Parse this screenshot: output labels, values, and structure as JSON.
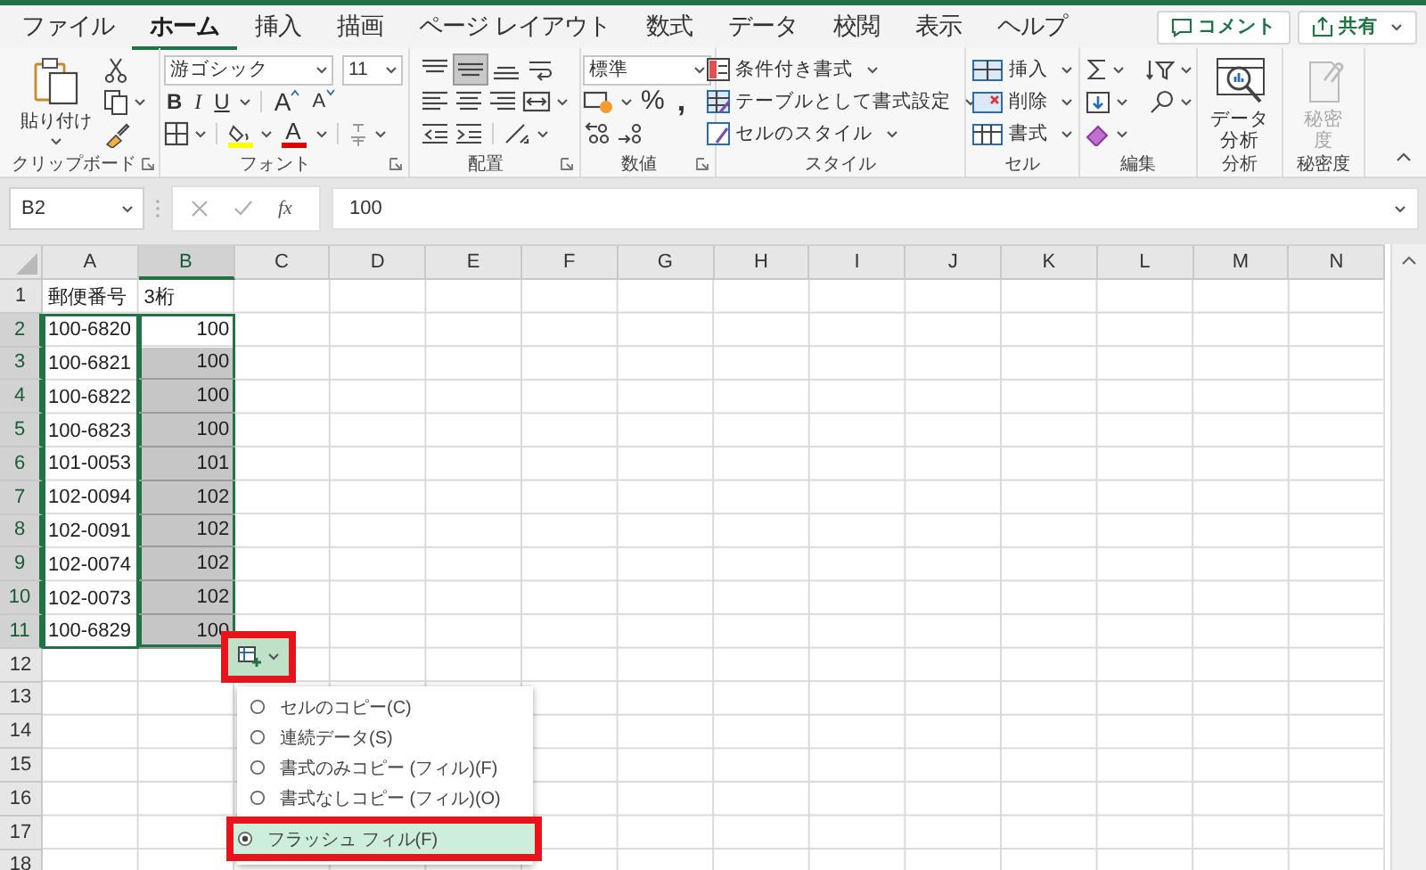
{
  "tabs": [
    {
      "label": "ファイル",
      "selected": false
    },
    {
      "label": "ホーム",
      "selected": true
    },
    {
      "label": "挿入",
      "selected": false
    },
    {
      "label": "描画",
      "selected": false
    },
    {
      "label": "ページ レイアウト",
      "selected": false
    },
    {
      "label": "数式",
      "selected": false
    },
    {
      "label": "データ",
      "selected": false
    },
    {
      "label": "校閲",
      "selected": false
    },
    {
      "label": "表示",
      "selected": false
    },
    {
      "label": "ヘルプ",
      "selected": false
    }
  ],
  "comment_button": {
    "label": "コメント"
  },
  "share_button": {
    "label": "共有"
  },
  "ribbon_groups": [
    {
      "kind": "clipboard",
      "label": "クリップボード",
      "paste_label": "貼り付け"
    },
    {
      "kind": "font",
      "label": "フォント",
      "font_name": "游ゴシック",
      "font_size": "11",
      "bold": "B",
      "italic": "I",
      "underline": "U",
      "grow": "A",
      "shrink": "A",
      "font_color": "A"
    },
    {
      "kind": "alignment",
      "label": "配置",
      "middle_align_pressed": true
    },
    {
      "kind": "number",
      "label": "数値",
      "format": "標準",
      "percent": "%",
      "comma": ","
    },
    {
      "kind": "styles",
      "label": "スタイル",
      "commands": [
        "条件付き書式",
        "テーブルとして書式設定",
        "セルのスタイル"
      ]
    },
    {
      "kind": "cells",
      "label": "セル",
      "commands": [
        "挿入",
        "削除",
        "書式"
      ]
    },
    {
      "kind": "editing",
      "label": "編集"
    },
    {
      "kind": "analysis",
      "label": "分析",
      "button": "データ分析"
    },
    {
      "kind": "sensitivity",
      "label": "秘密度",
      "button": "秘密度",
      "disabled": true
    }
  ],
  "formula_bar": {
    "name_box": "B2",
    "function_button": "fx",
    "value": "100"
  },
  "sheet": {
    "columns": [
      {
        "label": "A",
        "selected": false
      },
      {
        "label": "B",
        "selected": true
      },
      {
        "label": "C",
        "selected": false
      },
      {
        "label": "D",
        "selected": false
      },
      {
        "label": "E",
        "selected": false
      },
      {
        "label": "F",
        "selected": false
      },
      {
        "label": "G",
        "selected": false
      },
      {
        "label": "H",
        "selected": false
      },
      {
        "label": "I",
        "selected": false
      },
      {
        "label": "J",
        "selected": false
      },
      {
        "label": "K",
        "selected": false
      },
      {
        "label": "L",
        "selected": false
      },
      {
        "label": "M",
        "selected": false
      },
      {
        "label": "N",
        "selected": false
      }
    ],
    "rows": [
      {
        "number": "1",
        "selected": false,
        "cells": [
          {
            "text": "郵便番号",
            "kind": "text",
            "shaded": false
          },
          {
            "text": "3桁",
            "kind": "text",
            "shaded": false
          }
        ]
      },
      {
        "number": "2",
        "selected": true,
        "cells": [
          {
            "text": "100-6820",
            "kind": "text",
            "shaded": false
          },
          {
            "text": "100",
            "kind": "number",
            "shaded": false
          }
        ]
      },
      {
        "number": "3",
        "selected": true,
        "cells": [
          {
            "text": "100-6821",
            "kind": "text",
            "shaded": false
          },
          {
            "text": "100",
            "kind": "number",
            "shaded": true
          }
        ]
      },
      {
        "number": "4",
        "selected": true,
        "cells": [
          {
            "text": "100-6822",
            "kind": "text",
            "shaded": false
          },
          {
            "text": "100",
            "kind": "number",
            "shaded": true
          }
        ]
      },
      {
        "number": "5",
        "selected": true,
        "cells": [
          {
            "text": "100-6823",
            "kind": "text",
            "shaded": false
          },
          {
            "text": "100",
            "kind": "number",
            "shaded": true
          }
        ]
      },
      {
        "number": "6",
        "selected": true,
        "cells": [
          {
            "text": "101-0053",
            "kind": "text",
            "shaded": false
          },
          {
            "text": "101",
            "kind": "number",
            "shaded": true
          }
        ]
      },
      {
        "number": "7",
        "selected": true,
        "cells": [
          {
            "text": "102-0094",
            "kind": "text",
            "shaded": false
          },
          {
            "text": "102",
            "kind": "number",
            "shaded": true
          }
        ]
      },
      {
        "number": "8",
        "selected": true,
        "cells": [
          {
            "text": "102-0091",
            "kind": "text",
            "shaded": false
          },
          {
            "text": "102",
            "kind": "number",
            "shaded": true
          }
        ]
      },
      {
        "number": "9",
        "selected": true,
        "cells": [
          {
            "text": "102-0074",
            "kind": "text",
            "shaded": false
          },
          {
            "text": "102",
            "kind": "number",
            "shaded": true
          }
        ]
      },
      {
        "number": "10",
        "selected": true,
        "cells": [
          {
            "text": "102-0073",
            "kind": "text",
            "shaded": false
          },
          {
            "text": "102",
            "kind": "number",
            "shaded": true
          }
        ]
      },
      {
        "number": "11",
        "selected": true,
        "cells": [
          {
            "text": "100-6829",
            "kind": "text",
            "shaded": false
          },
          {
            "text": "100",
            "kind": "number",
            "shaded": true
          }
        ]
      },
      {
        "number": "12",
        "selected": false
      },
      {
        "number": "13",
        "selected": false
      },
      {
        "number": "14",
        "selected": false
      },
      {
        "number": "15",
        "selected": false
      },
      {
        "number": "16",
        "selected": false
      },
      {
        "number": "17",
        "selected": false
      },
      {
        "number": "18",
        "selected": false
      }
    ]
  },
  "fill_options": {
    "items": [
      {
        "label": "セルのコピー(C)",
        "selected": false
      },
      {
        "label": "連続データ(S)",
        "selected": false
      },
      {
        "label": "書式のみコピー (フィル)(F)",
        "selected": false
      },
      {
        "label": "書式なしコピー (フィル)(O)",
        "selected": false
      },
      {
        "label": "フラッシュ フィル(F)",
        "selected": true
      }
    ]
  }
}
